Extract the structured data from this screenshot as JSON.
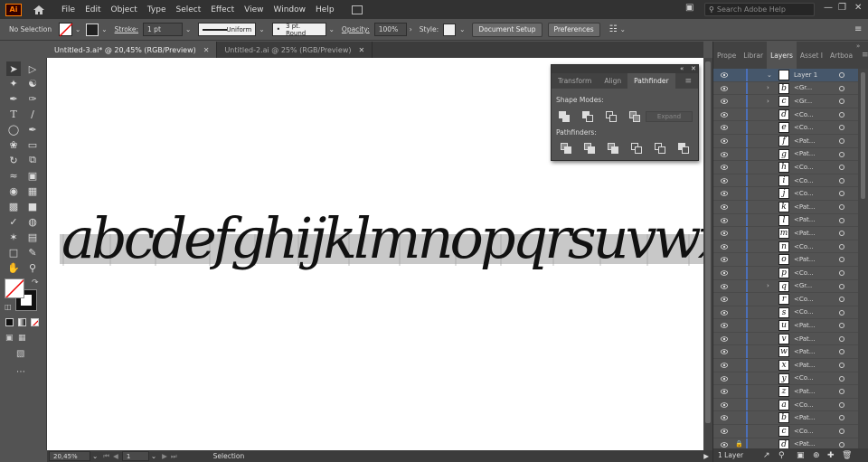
{
  "app": {
    "logo": "Ai"
  },
  "menu": [
    "File",
    "Edit",
    "Object",
    "Type",
    "Select",
    "Effect",
    "View",
    "Window",
    "Help"
  ],
  "search": {
    "placeholder": "Search Adobe Help"
  },
  "control": {
    "selection": "No Selection",
    "stroke_label": "Stroke:",
    "stroke_value": "1 pt",
    "uniform": "Uniform",
    "brush": "3 pt. Round",
    "opacity_label": "Opacity:",
    "opacity_value": "100%",
    "style_label": "Style:",
    "doc_setup": "Document Setup",
    "preferences": "Preferences"
  },
  "tabs": [
    {
      "label": "Untitled-3.ai* @ 20,45% (RGB/Preview)",
      "active": true
    },
    {
      "label": "Untitled-2.ai @ 25% (RGB/Preview)",
      "active": false
    }
  ],
  "canvas": {
    "text": "abcdefghijklmnopqrsuvwxyz"
  },
  "pathfinder": {
    "tabs": [
      "Transform",
      "Align",
      "Pathfinder"
    ],
    "shape_modes": "Shape Modes:",
    "expand": "Expand",
    "pathfinders": "Pathfinders:"
  },
  "status": {
    "zoom": "20,45%",
    "artboard": "1",
    "tool": "Selection"
  },
  "right_tabs": [
    "Prope",
    "Librar",
    "Layers",
    "Asset I",
    "Artboa"
  ],
  "layers": [
    {
      "name": "Layer 1",
      "chev": "v"
    },
    {
      "name": "<Gr...",
      "chev": ">"
    },
    {
      "name": "<Gr...",
      "chev": ">"
    },
    {
      "name": "<Co...",
      "chev": ""
    },
    {
      "name": "<Co...",
      "chev": ""
    },
    {
      "name": "<Pat...",
      "chev": ""
    },
    {
      "name": "<Pat...",
      "chev": ""
    },
    {
      "name": "<Co...",
      "chev": ""
    },
    {
      "name": "<Co...",
      "chev": ""
    },
    {
      "name": "<Co...",
      "chev": ""
    },
    {
      "name": "<Pat...",
      "chev": ""
    },
    {
      "name": "<Pat...",
      "chev": ""
    },
    {
      "name": "<Pat...",
      "chev": ""
    },
    {
      "name": "<Co...",
      "chev": ""
    },
    {
      "name": "<Pat...",
      "chev": ""
    },
    {
      "name": "<Co...",
      "chev": ""
    },
    {
      "name": "<Gr...",
      "chev": ">"
    },
    {
      "name": "<Co...",
      "chev": ""
    },
    {
      "name": "<Co...",
      "chev": ""
    },
    {
      "name": "<Pat...",
      "chev": ""
    },
    {
      "name": "<Pat...",
      "chev": ""
    },
    {
      "name": "<Pat...",
      "chev": ""
    },
    {
      "name": "<Pat...",
      "chev": ""
    },
    {
      "name": "<Co...",
      "chev": ""
    },
    {
      "name": "<Pat...",
      "chev": ""
    },
    {
      "name": "<Co...",
      "chev": ""
    },
    {
      "name": "<Pat...",
      "chev": ""
    },
    {
      "name": "<Co...",
      "chev": ""
    },
    {
      "name": "<Pat...",
      "chev": ""
    }
  ],
  "layers_footer": "1 Layer"
}
